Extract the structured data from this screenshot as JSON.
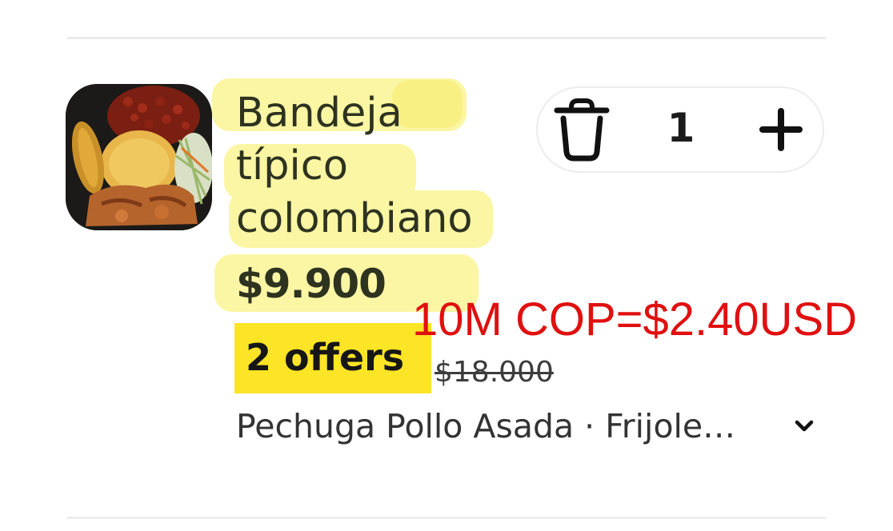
{
  "item": {
    "title_lines": [
      "Bandeja",
      "típico",
      "colombiano"
    ],
    "price": "$9.900",
    "offers_label": "2 offers",
    "original_price": "$18.000",
    "description": "Pechuga Pollo Asada · Frijole…",
    "quantity": "1"
  },
  "overlay_note": "10M COP=$2.40USD",
  "icons": {
    "remove": "trash-icon",
    "add": "plus-icon",
    "expand": "chevron-down-icon"
  },
  "colors": {
    "highlight": "#fbf6a4",
    "offers_badge": "#fce426",
    "overlay_text": "#e01010",
    "title_text": "#2e3320"
  }
}
